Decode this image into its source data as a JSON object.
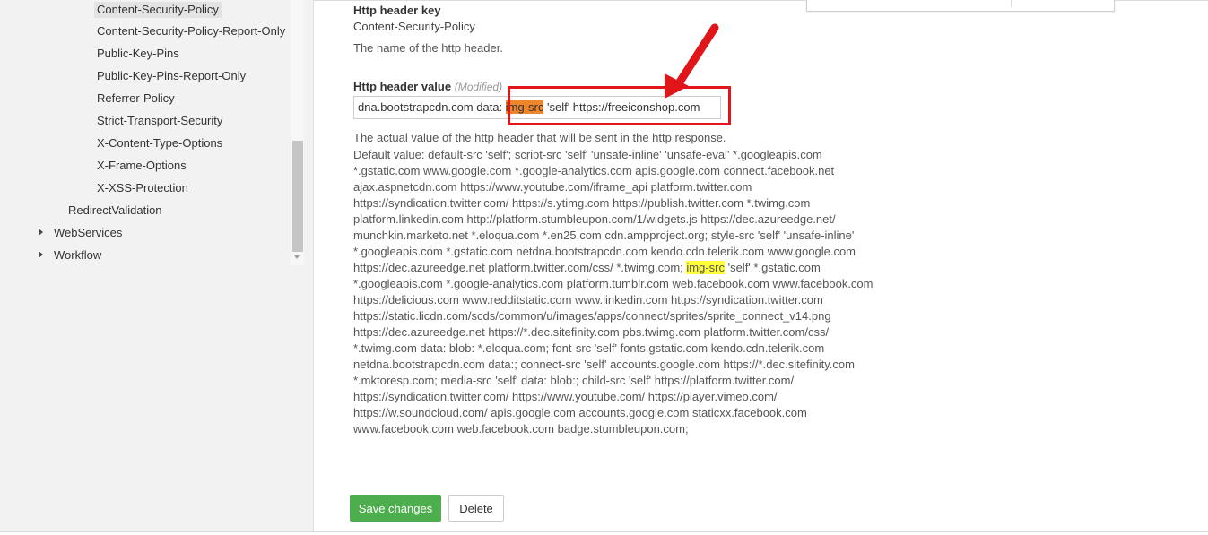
{
  "sidebar": {
    "items": [
      {
        "label": "Content-Security-Policy"
      },
      {
        "label": "Content-Security-Policy-Report-Only"
      },
      {
        "label": "Public-Key-Pins"
      },
      {
        "label": "Public-Key-Pins-Report-Only"
      },
      {
        "label": "Referrer-Policy"
      },
      {
        "label": "Strict-Transport-Security"
      },
      {
        "label": "X-Content-Type-Options"
      },
      {
        "label": "X-Frame-Options"
      },
      {
        "label": "X-XSS-Protection"
      },
      {
        "label": "RedirectValidation"
      },
      {
        "label": "WebServices"
      },
      {
        "label": "Workflow"
      }
    ]
  },
  "form": {
    "key_label": "Http header key",
    "key_value": "Content-Security-Policy",
    "key_desc": "The name of the http header.",
    "value_label": "Http header value",
    "modified": "(Modified)",
    "input_before": "dna.bootstrapcdn.com data: ",
    "input_highlight": "img-src",
    "input_after": " 'self' https://freeiconshop.com",
    "value_desc": "The actual value of the http header that will be sent in the http response.",
    "default_before": "Default value: default-src 'self'; script-src 'self' 'unsafe-inline' 'unsafe-eval' *.googleapis.com *.gstatic.com www.google.com *.google-analytics.com apis.google.com connect.facebook.net ajax.aspnetcdn.com https://www.youtube.com/iframe_api platform.twitter.com https://syndication.twitter.com/ https://s.ytimg.com https://publish.twitter.com *.twimg.com platform.linkedin.com http://platform.stumbleupon.com/1/widgets.js https://dec.azureedge.net/ munchkin.marketo.net *.eloqua.com *.en25.com cdn.ampproject.org; style-src 'self' 'unsafe-inline' *.googleapis.com *.gstatic.com netdna.bootstrapcdn.com kendo.cdn.telerik.com www.google.com https://dec.azureedge.net platform.twitter.com/css/ *.twimg.com; ",
    "default_highlight": "img-src",
    "default_after": " 'self' *.gstatic.com *.googleapis.com *.google-analytics.com platform.tumblr.com web.facebook.com www.facebook.com https://delicious.com www.redditstatic.com www.linkedin.com https://syndication.twitter.com https://static.licdn.com/scds/common/u/images/apps/connect/sprites/sprite_connect_v14.png https://dec.azureedge.net https://*.dec.sitefinity.com pbs.twimg.com platform.twitter.com/css/ *.twimg.com data: blob: *.eloqua.com; font-src 'self' fonts.gstatic.com kendo.cdn.telerik.com netdna.bootstrapcdn.com data:; connect-src 'self' accounts.google.com https://*.dec.sitefinity.com *.mktoresp.com; media-src 'self' data: blob:; child-src 'self' https://platform.twitter.com/ https://syndication.twitter.com/ https://www.youtube.com/ https://player.vimeo.com/ https://w.soundcloud.com/ apis.google.com accounts.google.com staticxx.facebook.com www.facebook.com web.facebook.com badge.stumbleupon.com;",
    "save_label": "Save changes",
    "delete_label": "Delete"
  },
  "colors": {
    "save_button": "#4cae4c",
    "annotation": "#e0161b",
    "highlight_orange": "#f0862b",
    "highlight_yellow": "#ffff3a"
  }
}
